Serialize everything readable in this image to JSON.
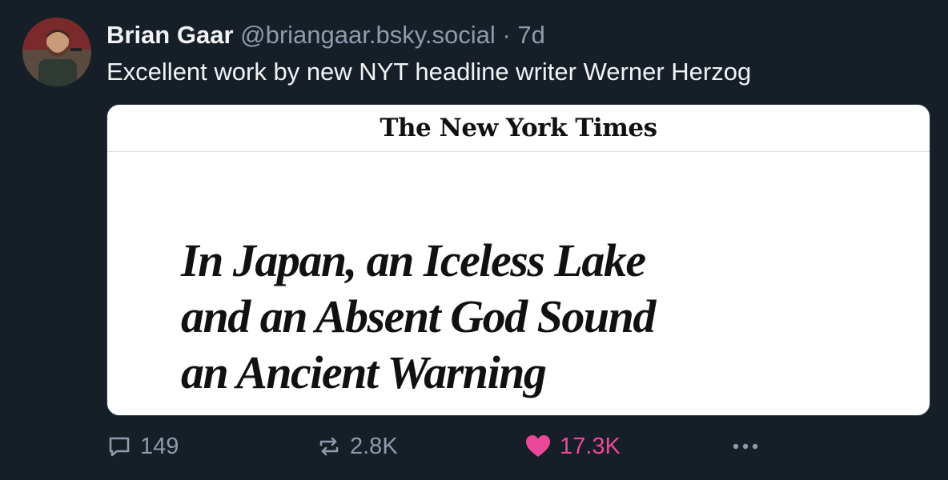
{
  "post": {
    "author_name": "Brian Gaar",
    "handle": "@briangaar.bsky.social",
    "separator": "·",
    "time": "7d",
    "text": "Excellent work by new NYT headline writer Werner Herzog"
  },
  "embed": {
    "masthead": "The New York Times",
    "headline_lines": [
      "In Japan, an Iceless Lake",
      "and an Absent God Sound",
      "an Ancient Warning"
    ]
  },
  "actions": {
    "reply_count": "149",
    "repost_count": "2.8K",
    "like_count": "17.3K"
  },
  "icons": {
    "reply": "reply-icon",
    "repost": "repost-icon",
    "like": "heart-icon",
    "more": "more-icon"
  },
  "colors": {
    "background": "#161e27",
    "muted_text": "#8e9bab",
    "like_accent": "#ec4899"
  }
}
